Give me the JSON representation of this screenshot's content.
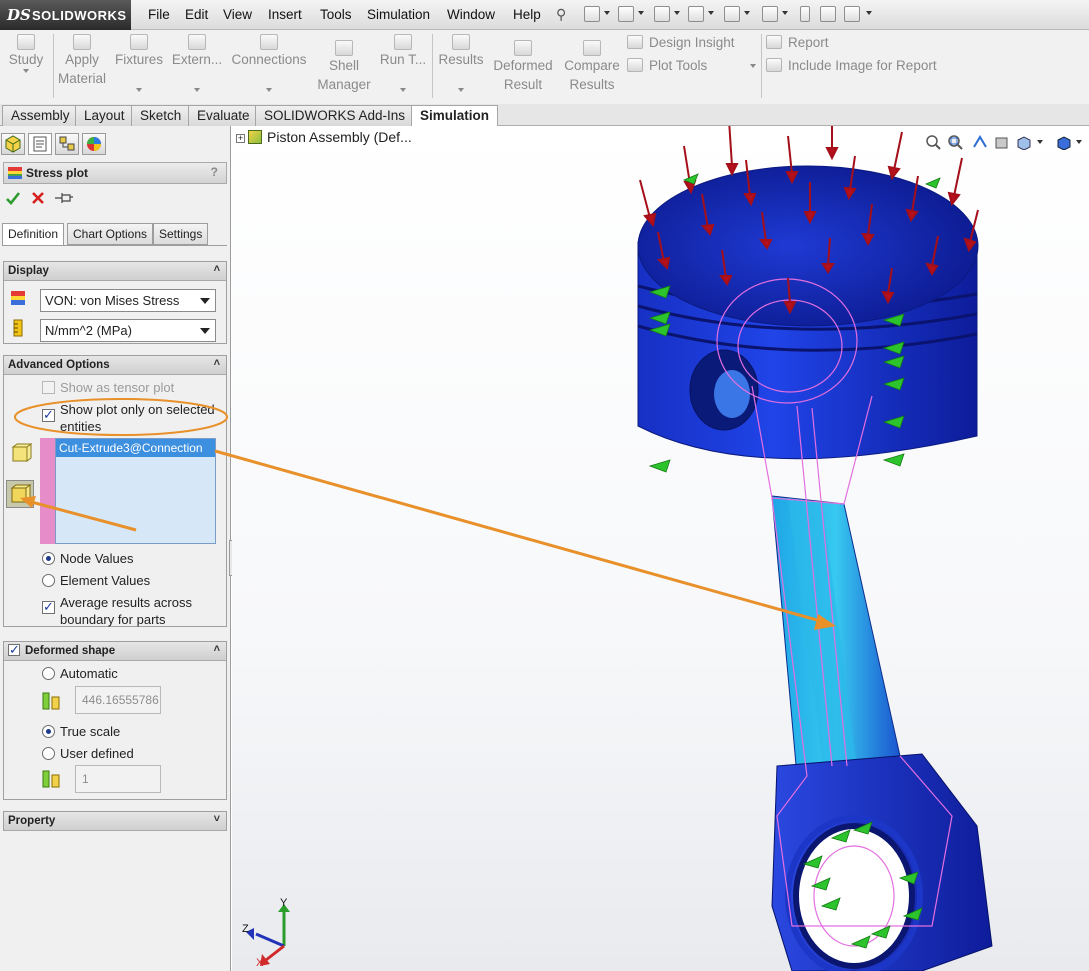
{
  "app": {
    "logo_ds": "DS",
    "logo_text": "SOLIDWORKS"
  },
  "menu": [
    "File",
    "Edit",
    "View",
    "Insert",
    "Tools",
    "Simulation",
    "Window",
    "Help"
  ],
  "ribbon": {
    "study": "Study",
    "apply_material_1": "Apply",
    "apply_material_2": "Material",
    "fixtures": "Fixtures",
    "external": "Extern...",
    "connections": "Connections",
    "shell_manager_1": "Shell",
    "shell_manager_2": "Manager",
    "run": "Run T...",
    "results": "Results",
    "deformed_result_1": "Deformed",
    "deformed_result_2": "Result",
    "compare_results_1": "Compare",
    "compare_results_2": "Results",
    "design_insight": "Design Insight",
    "plot_tools": "Plot Tools",
    "report": "Report",
    "include_image": "Include Image for Report"
  },
  "tabs": [
    "Assembly",
    "Layout",
    "Sketch",
    "Evaluate",
    "SOLIDWORKS Add-Ins",
    "Simulation"
  ],
  "active_tab": "Simulation",
  "property_manager": {
    "title": "Stress plot",
    "help": "?",
    "subtabs": [
      "Definition",
      "Chart Options",
      "Settings"
    ],
    "display": {
      "header": "Display",
      "component": "VON: von Mises Stress",
      "units": "N/mm^2 (MPa)"
    },
    "advanced": {
      "header": "Advanced Options",
      "tensor_label": "Show as tensor plot",
      "show_selected_label_1": "Show plot only on selected",
      "show_selected_label_2": "entities",
      "selected_entity": "Cut-Extrude3@Connection",
      "node_values": "Node Values",
      "element_values": "Element Values",
      "average_label_1": "Average results across",
      "average_label_2": "boundary for parts"
    },
    "deformed": {
      "header": "Deformed shape",
      "automatic": "Automatic",
      "auto_value": "446.16555786",
      "true_scale": "True scale",
      "user_defined": "User defined",
      "user_value": "1"
    },
    "property": {
      "header": "Property"
    }
  },
  "graphics": {
    "tree_label": "Piston Assembly  (Def...",
    "triad": {
      "x": "X",
      "y": "Y",
      "z": "Z"
    }
  },
  "colors": {
    "accent_blue": "#1f3fd1",
    "dark_blue": "#0a1a8c",
    "highlight_orange": "#e8902a",
    "load_arrow_red": "#b5101b",
    "fixture_green": "#2cc32c",
    "selection_blue": "#3d8fe0"
  }
}
